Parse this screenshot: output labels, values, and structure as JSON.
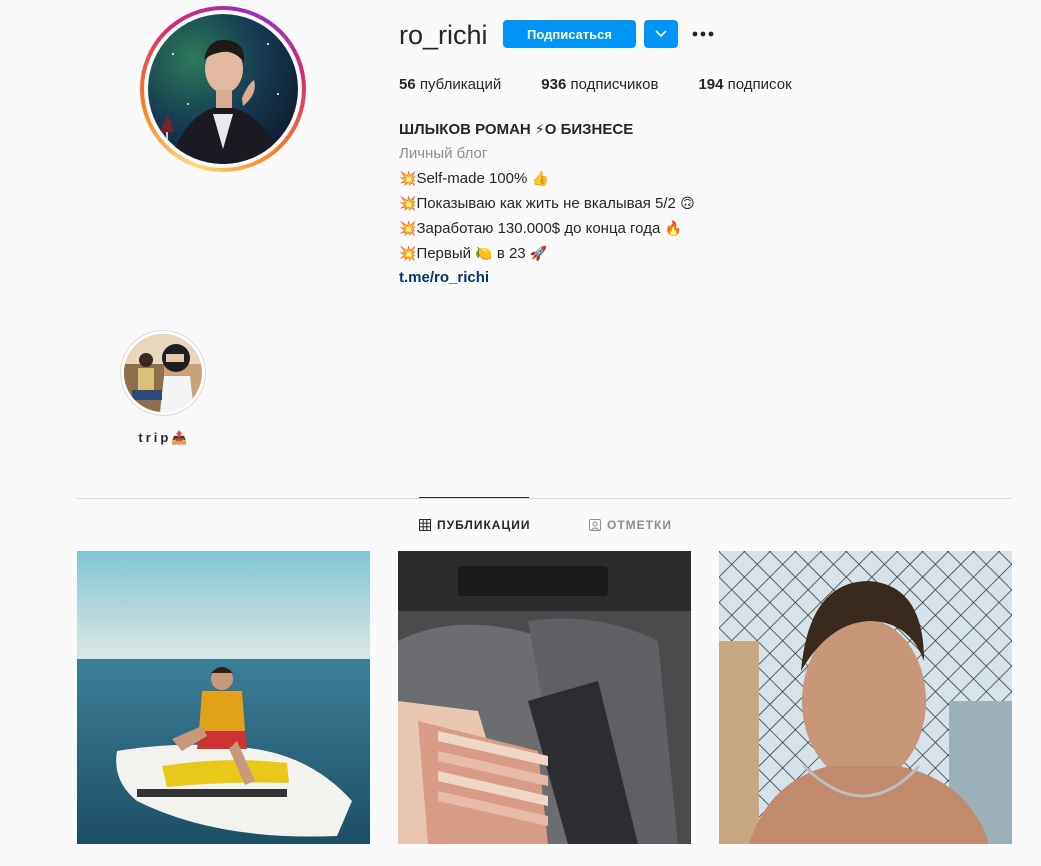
{
  "profile": {
    "username": "ro_richi",
    "follow_label": "Подписаться",
    "stats": {
      "posts_count": "56",
      "posts_label": "публикаций",
      "followers_count": "936",
      "followers_label": "подписчиков",
      "following_count": "194",
      "following_label": "подписок"
    },
    "bio": {
      "name": "ШЛЫКОВ РОМАН",
      "name_suffix": "О БИЗНЕСЕ",
      "category": "Личный блог",
      "line1": "Self-made 100%",
      "line2": "Показываю как жить не вкалывая 5/2",
      "line3": "Заработаю 130.000$ до конца года",
      "line4_a": "Первый",
      "line4_b": "в 23",
      "link": "t.me/ro_richi"
    }
  },
  "highlights": [
    {
      "label": "trip"
    }
  ],
  "tabs": {
    "posts_label": "ПУБЛИКАЦИИ",
    "tagged_label": "ОТМЕТКИ"
  },
  "icons": {
    "dropdown": "chevron-down-icon",
    "more": "more-options-icon",
    "grid": "grid-icon",
    "tagged": "tagged-icon"
  },
  "colors": {
    "accent": "#0095f6",
    "link": "#00376b",
    "muted": "#8e8e8e"
  }
}
